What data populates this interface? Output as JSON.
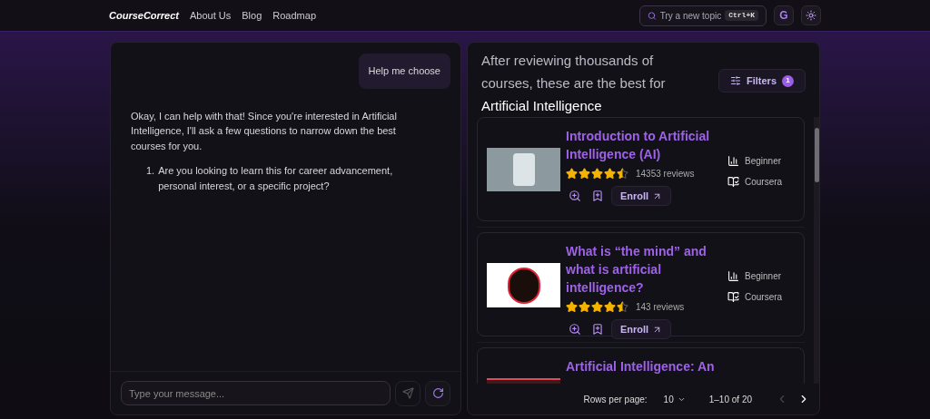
{
  "nav": {
    "logo": "CourseCorrect",
    "links": [
      "About Us",
      "Blog",
      "Roadmap"
    ],
    "search": {
      "placeholder": "Try a new topic",
      "shortcut": "Ctrl+K"
    },
    "account_letter": "G"
  },
  "chat": {
    "messages": [
      {
        "kind": "user",
        "text": "Help me choose"
      },
      {
        "kind": "bot",
        "text": "Okay, I can help with that! Since you're interested in Artificial Intelligence, I'll ask a few questions to narrow down the best courses for you.",
        "list": [
          {
            "marker": "1.",
            "text": "Are you looking to learn this for career advancement, personal interest, or a specific project?"
          }
        ]
      }
    ],
    "input": {
      "placeholder": "Type your message..."
    },
    "send_disabled": true
  },
  "results": {
    "heading": "After reviewing thousands of courses, these are the best",
    "heading_prefix": "for",
    "topic": "Artificial Intelligence",
    "filters": {
      "label": "Filters",
      "count": "1"
    },
    "courses": [
      {
        "title": "Introduction to Artificial Intelligence (AI)",
        "stars": 4.5,
        "reviews": "14353 reviews",
        "level": "Beginner",
        "provider": "Coursera",
        "enroll": "Enroll"
      },
      {
        "title": "What is “the mind” and what is artificial intelligence?",
        "stars": 4.5,
        "reviews": "143 reviews",
        "level": "Beginner",
        "provider": "Coursera",
        "enroll": "Enroll"
      },
      {
        "title": "Artificial Intelligence: An"
      }
    ],
    "pagination": {
      "rows_label": "Rows per page:",
      "rows_value": "10",
      "range": "1–10 of 20",
      "prev_disabled": true,
      "next_disabled": false
    }
  }
}
